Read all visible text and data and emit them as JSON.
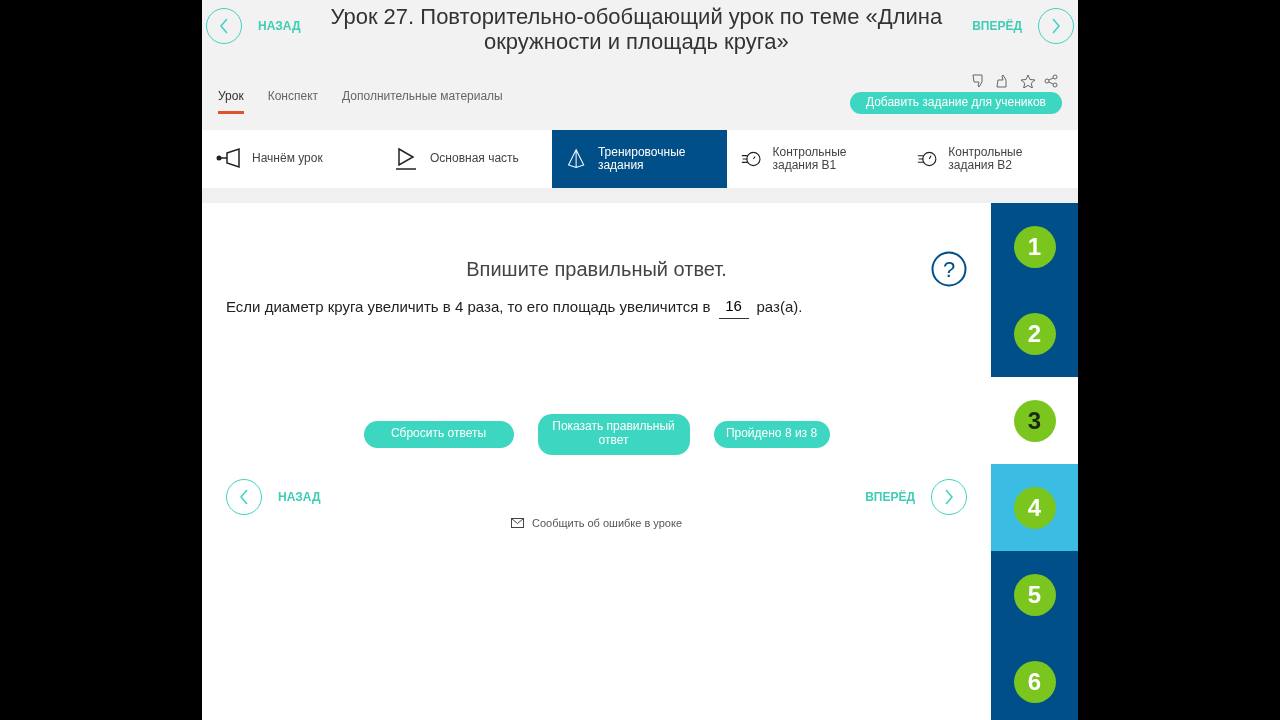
{
  "header": {
    "back_label": "НАЗАД",
    "title": "Урок 27. Повторительно-обобщающий урок по теме «Длина окружности и площадь круга»",
    "forward_label": "ВПЕРЁД"
  },
  "tabs": [
    {
      "label": "Урок",
      "selected": true
    },
    {
      "label": "Конспект",
      "selected": false
    },
    {
      "label": "Дополнительные материалы",
      "selected": false
    }
  ],
  "add_task_button": "Добавить задание для учеников",
  "sections": [
    {
      "kind": "start",
      "label": "Начнём урок",
      "selected": false
    },
    {
      "kind": "main",
      "label": "Основная часть",
      "selected": false
    },
    {
      "kind": "training",
      "label": "Тренировочные задания",
      "selected": true
    },
    {
      "kind": "control1",
      "label": "Контрольные задания В1",
      "selected": false
    },
    {
      "kind": "control2",
      "label": "Контрольные задания В2",
      "selected": false
    }
  ],
  "task": {
    "instruction": "Впишите правильный ответ.",
    "text_before": "Если диаметр круга увеличить в 4 раза, то его площадь увеличится в",
    "answer": "16",
    "text_after": "раз(а)."
  },
  "help_button": "?",
  "buttons": [
    "Сбросить ответы",
    "Показать правильный ответ",
    "Пройдено 8 из 8"
  ],
  "bottom_nav": {
    "back_label": "НАЗАД",
    "forward_label": "ВПЕРЁД"
  },
  "report_link": "Сообщить об ошибке в уроке",
  "task_numbers": [
    {
      "label": "1",
      "selected": false,
      "highlighted": false
    },
    {
      "label": "2",
      "selected": false,
      "highlighted": false
    },
    {
      "label": "3",
      "selected": true,
      "highlighted": false
    },
    {
      "label": "4",
      "selected": false,
      "highlighted": true
    },
    {
      "label": "5",
      "selected": false,
      "highlighted": false
    },
    {
      "label": "6",
      "selected": false,
      "highlighted": false
    }
  ]
}
